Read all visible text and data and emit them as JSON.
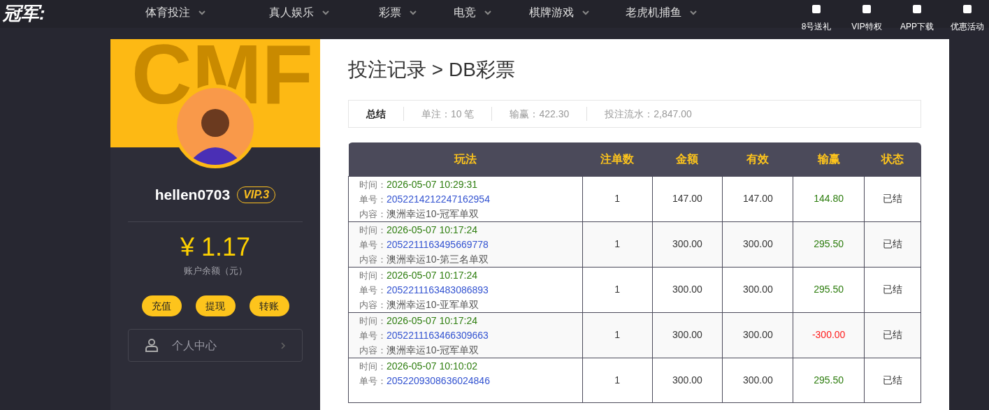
{
  "header": {
    "logo": "冠军:",
    "nav": [
      {
        "label": "体育投注"
      },
      {
        "label": "真人娱乐"
      },
      {
        "label": "彩票"
      },
      {
        "label": "电竞"
      },
      {
        "label": "棋牌游戏"
      },
      {
        "label": "老虎机捕鱼"
      }
    ],
    "shortcuts": [
      {
        "label": "8号送礼"
      },
      {
        "label": "VIP特权"
      },
      {
        "label": "APP下载"
      },
      {
        "label": "优惠活动"
      }
    ]
  },
  "profile": {
    "banner_text": "CMF",
    "username": "hellen0703",
    "vip": "VIP.3",
    "balance": "¥ 1.17",
    "balance_label": "账户余额（元）",
    "actions": [
      "充值",
      "提现",
      "转账"
    ],
    "menu": [
      {
        "label": "个人中心"
      }
    ]
  },
  "page": {
    "title": "投注记录 > DB彩票",
    "summary": [
      {
        "label": "总结",
        "kind": "title"
      },
      {
        "label": "单注：10 笔",
        "kind": "stat"
      },
      {
        "label": "输赢：422.30",
        "kind": "stat"
      },
      {
        "label": "投注流水：2,847.00",
        "kind": "stat"
      }
    ],
    "table": {
      "columns": [
        "玩法",
        "注单数",
        "金额",
        "有效",
        "输赢",
        "状态"
      ],
      "rows": [
        {
          "time_label": "时间：",
          "time": "2026-05-07 10:29:31",
          "no_label": "单号：",
          "no": "2052214212247162954",
          "content_label": "内容：",
          "content": "澳洲幸运10-冠军单双",
          "count": "1",
          "amount": "147.00",
          "valid": "147.00",
          "result": "144.80",
          "color": "#2d7d0e",
          "status": "已结"
        },
        {
          "time_label": "时间：",
          "time": "2026-05-07 10:17:24",
          "no_label": "单号：",
          "no": "2052211163495669778",
          "content_label": "内容：",
          "content": "澳洲幸运10-第三名单双",
          "count": "1",
          "amount": "300.00",
          "valid": "300.00",
          "result": "295.50",
          "color": "#2d7d0e",
          "status": "已结"
        },
        {
          "time_label": "时间：",
          "time": "2026-05-07 10:17:24",
          "no_label": "单号：",
          "no": "2052211163483086893",
          "content_label": "内容：",
          "content": "澳洲幸运10-亚军单双",
          "count": "1",
          "amount": "300.00",
          "valid": "300.00",
          "result": "295.50",
          "color": "#2d7d0e",
          "status": "已结"
        },
        {
          "time_label": "时间：",
          "time": "2026-05-07 10:17:24",
          "no_label": "单号：",
          "no": "2052211163466309663",
          "content_label": "内容：",
          "content": "澳洲幸运10-冠军单双",
          "count": "1",
          "amount": "300.00",
          "valid": "300.00",
          "result": "-300.00",
          "color": "#ff1a1a",
          "status": "已结"
        },
        {
          "time_label": "时间：",
          "time": "2026-05-07 10:10:02",
          "no_label": "单号：",
          "no": "2052209308636024846",
          "count": "1",
          "amount": "300.00",
          "valid": "300.00",
          "result": "295.50",
          "color": "#2d7d0e",
          "status": "已结"
        }
      ]
    }
  }
}
